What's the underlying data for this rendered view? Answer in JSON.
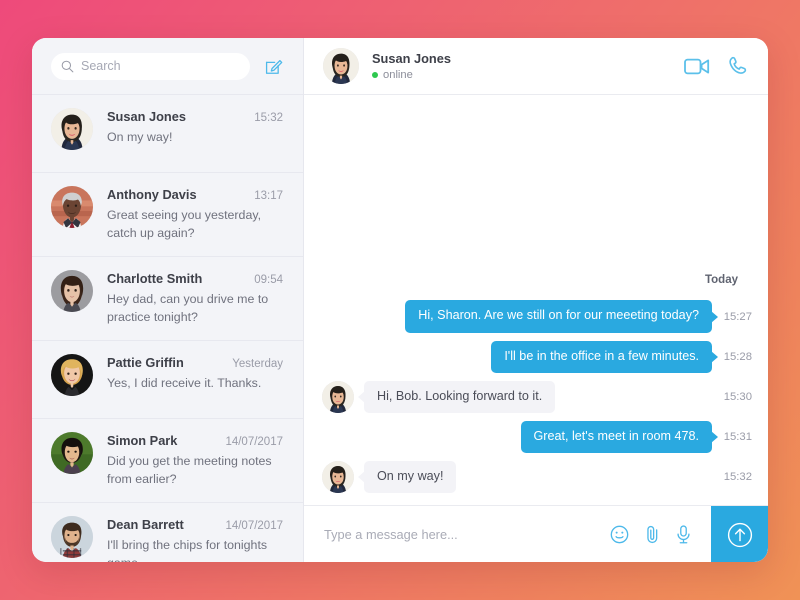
{
  "theme": {
    "gradient_start": "#ee4a7b",
    "gradient_end": "#f09256",
    "accent_blue": "#2aa9e0",
    "icon_blue": "#5bc0ea",
    "sidebar_bg": "#f3f4f8",
    "incoming_bubble": "#f3f3f7",
    "online_green": "#2ec84f"
  },
  "sidebar": {
    "search": {
      "placeholder": "Search",
      "value": "",
      "icon": "search-icon"
    },
    "compose": {
      "icon": "compose-pencil-icon",
      "label": "New message"
    },
    "conversations": [
      {
        "name": "Susan Jones",
        "time": "15:32",
        "preview": "On my way!",
        "avatar": "woman-dark-hair"
      },
      {
        "name": "Anthony Davis",
        "time": "13:17",
        "preview": "Great seeing you yesterday, catch up again?",
        "avatar": "man-gray-hair"
      },
      {
        "name": "Charlotte Smith",
        "time": "09:54",
        "preview": "Hey dad, can you drive me to practice tonight?",
        "avatar": "young-woman"
      },
      {
        "name": "Pattie Griffin",
        "time": "Yesterday",
        "preview": "Yes, I did receive it. Thanks.",
        "avatar": "blonde-woman"
      },
      {
        "name": "Simon Park",
        "time": "14/07/2017",
        "preview": "Did you get the meeting notes from earlier?",
        "avatar": "man-green-bg"
      },
      {
        "name": "Dean Barrett",
        "time": "14/07/2017",
        "preview": "I'll bring the chips for tonights game.",
        "avatar": "bearded-man"
      }
    ]
  },
  "chat": {
    "header": {
      "name": "Susan Jones",
      "status": "online",
      "avatar": "woman-dark-hair",
      "video_call_icon": "video-camera-icon",
      "voice_call_icon": "phone-icon"
    },
    "day_separator": "Today",
    "messages": [
      {
        "direction": "out",
        "text": "Hi, Sharon. Are we still on for our meeeting today?",
        "time": "15:27"
      },
      {
        "direction": "out",
        "text": "I'll be in the office in a few minutes.",
        "time": "15:28"
      },
      {
        "direction": "in",
        "text": "Hi, Bob. Looking forward to it.",
        "time": "15:30",
        "avatar": "woman-dark-hair"
      },
      {
        "direction": "out",
        "text": "Great, let's meet in room 478.",
        "time": "15:31"
      },
      {
        "direction": "in",
        "text": "On my way!",
        "time": "15:32",
        "avatar": "woman-dark-hair"
      }
    ],
    "composer": {
      "placeholder": "Type a message here...",
      "value": "",
      "emoji_icon": "smiley-icon",
      "attach_icon": "paperclip-icon",
      "mic_icon": "microphone-icon",
      "send_icon": "arrow-up-circle-icon"
    }
  }
}
